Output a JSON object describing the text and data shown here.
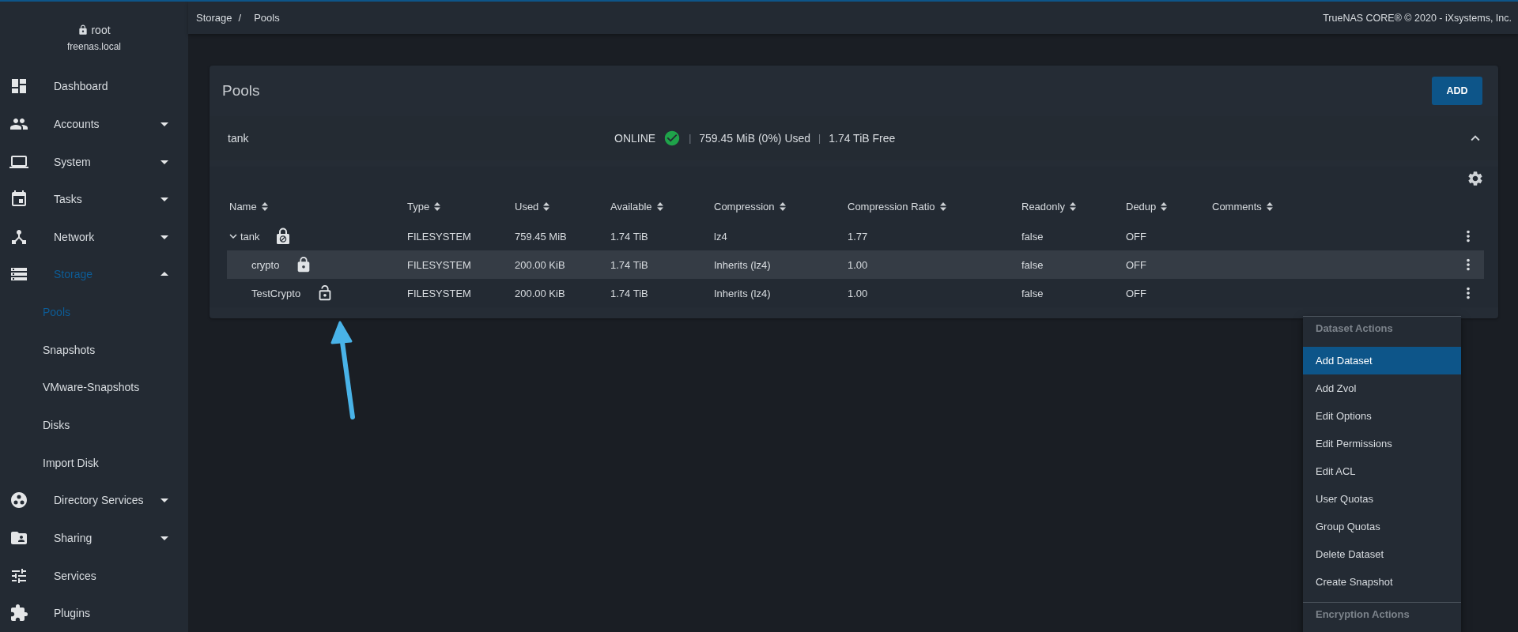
{
  "sidebar": {
    "user": "root",
    "host": "freenas.local",
    "items": [
      {
        "label": "Dashboard",
        "selected": false
      },
      {
        "label": "Accounts",
        "selected": false,
        "expanded": false
      },
      {
        "label": "System",
        "selected": false,
        "expanded": false
      },
      {
        "label": "Tasks",
        "selected": false,
        "expanded": false
      },
      {
        "label": "Network",
        "selected": false,
        "expanded": false
      },
      {
        "label": "Storage",
        "selected": true,
        "expanded": true,
        "children": [
          {
            "label": "Pools",
            "selected": true
          },
          {
            "label": "Snapshots",
            "selected": false
          },
          {
            "label": "VMware-Snapshots",
            "selected": false
          },
          {
            "label": "Disks",
            "selected": false
          },
          {
            "label": "Import Disk",
            "selected": false
          }
        ]
      },
      {
        "label": "Directory Services",
        "selected": false,
        "expanded": false
      },
      {
        "label": "Sharing",
        "selected": false,
        "expanded": false
      },
      {
        "label": "Services",
        "selected": false
      },
      {
        "label": "Plugins",
        "selected": false
      }
    ]
  },
  "topbar": {
    "breadcrumb": [
      "Storage",
      "Pools"
    ],
    "separator": "/",
    "copyright": "TrueNAS CORE® © 2020 - iXsystems, Inc."
  },
  "pools": {
    "title": "Pools",
    "add_button": "ADD",
    "pool": {
      "name": "tank",
      "status": "ONLINE",
      "used": "759.45 MiB (0%) Used",
      "divider": "|",
      "free": "1.74 TiB Free",
      "expanded": true
    },
    "table": {
      "columns": [
        "Name",
        "Type",
        "Used",
        "Available",
        "Compression",
        "Compression Ratio",
        "Readonly",
        "Dedup",
        "Comments"
      ],
      "rows": [
        {
          "kind": "blocked",
          "selected": false,
          "expanded": true,
          "cells": [
            "tank",
            "FILESYSTEM",
            "759.45 MiB",
            "1.74 TiB",
            "lz4",
            "1.77",
            "false",
            "OFF"
          ],
          "children": [
            {
              "kind": "locked",
              "selected": true,
              "cells": [
                "crypto",
                "FILESYSTEM",
                "200.00 KiB",
                "1.74 TiB",
                "Inherits (lz4)",
                "1.00",
                "false",
                "OFF"
              ]
            },
            {
              "kind": "unlocked",
              "selected": false,
              "cells": [
                "TestCrypto",
                "FILESYSTEM",
                "200.00 KiB",
                "1.74 TiB",
                "Inherits (lz4)",
                "1.00",
                "false",
                "OFF"
              ]
            }
          ]
        }
      ]
    }
  },
  "menu": {
    "sections": [
      {
        "title": "Dataset Actions",
        "items": [
          {
            "label": "Add Dataset",
            "selected": true
          },
          {
            "label": "Add Zvol",
            "selected": false
          },
          {
            "label": "Edit Options",
            "selected": false
          },
          {
            "label": "Edit Permissions",
            "selected": false
          },
          {
            "label": "Edit ACL",
            "selected": false
          },
          {
            "label": "User Quotas",
            "selected": false
          },
          {
            "label": "Group Quotas",
            "selected": false
          },
          {
            "label": "Delete Dataset",
            "selected": false
          },
          {
            "label": "Create Snapshot",
            "selected": false
          }
        ]
      },
      {
        "title": "Encryption Actions"
      }
    ]
  }
}
